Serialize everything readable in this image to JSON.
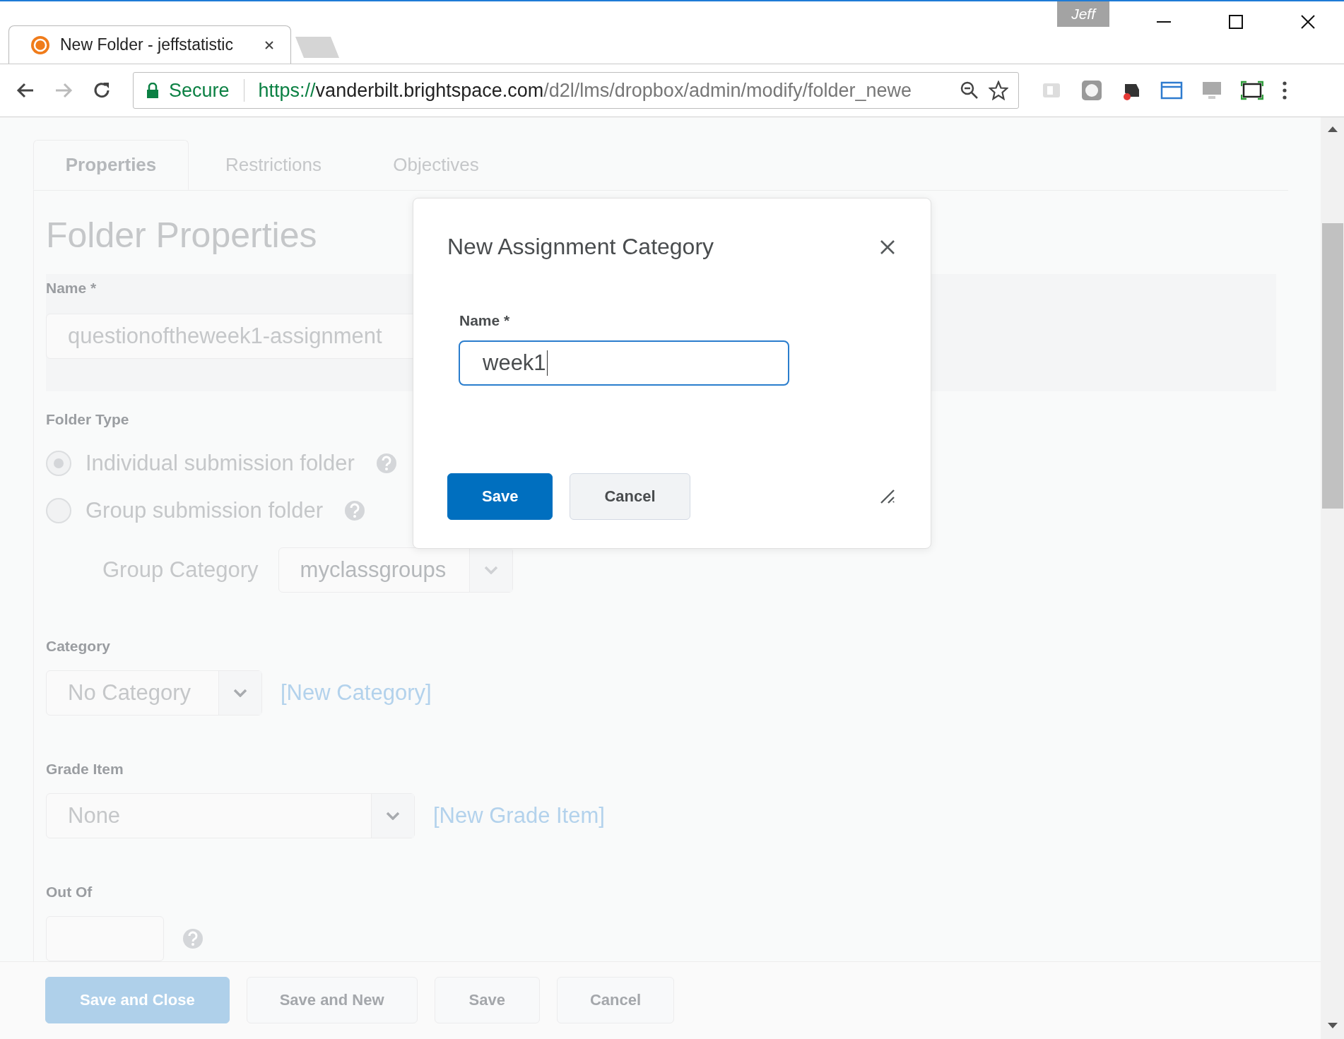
{
  "browser": {
    "tab": {
      "title": "New Folder - jeffstatistic"
    },
    "profile": "Jeff",
    "address": {
      "security": "Secure",
      "url_scheme": "https://",
      "url_host": "vanderbilt.brightspace.com",
      "url_path": "/d2l/lms/dropbox/admin/modify/folder_newe"
    }
  },
  "tabs": [
    {
      "label": "Properties",
      "selected": true
    },
    {
      "label": "Restrictions",
      "selected": false
    },
    {
      "label": "Objectives",
      "selected": false
    }
  ],
  "page_title": "Folder Properties",
  "name_field": {
    "label": "Name *",
    "value": "questionoftheweek1-assignment"
  },
  "folder_type": {
    "label": "Folder Type",
    "options": [
      {
        "label": "Individual submission folder",
        "selected": true
      },
      {
        "label": "Group submission folder",
        "selected": false
      }
    ]
  },
  "group_category": {
    "label": "Group Category",
    "value": "myclassgroups"
  },
  "category": {
    "label": "Category",
    "value": "No Category",
    "link": "[New Category]"
  },
  "grade_item": {
    "label": "Grade Item",
    "value": "None",
    "link": "[New Grade Item]"
  },
  "out_of": {
    "label": "Out Of"
  },
  "footer_buttons": [
    {
      "label": "Save and Close",
      "kind": "primary"
    },
    {
      "label": "Save and New",
      "kind": "secondary"
    },
    {
      "label": "Save",
      "kind": "secondary"
    },
    {
      "label": "Cancel",
      "kind": "secondary"
    }
  ],
  "dialog": {
    "title": "New Assignment Category",
    "field_label": "Name *",
    "value": "week1",
    "buttons": [
      {
        "label": "Save",
        "kind": "primary"
      },
      {
        "label": "Cancel",
        "kind": "secondary"
      }
    ]
  }
}
